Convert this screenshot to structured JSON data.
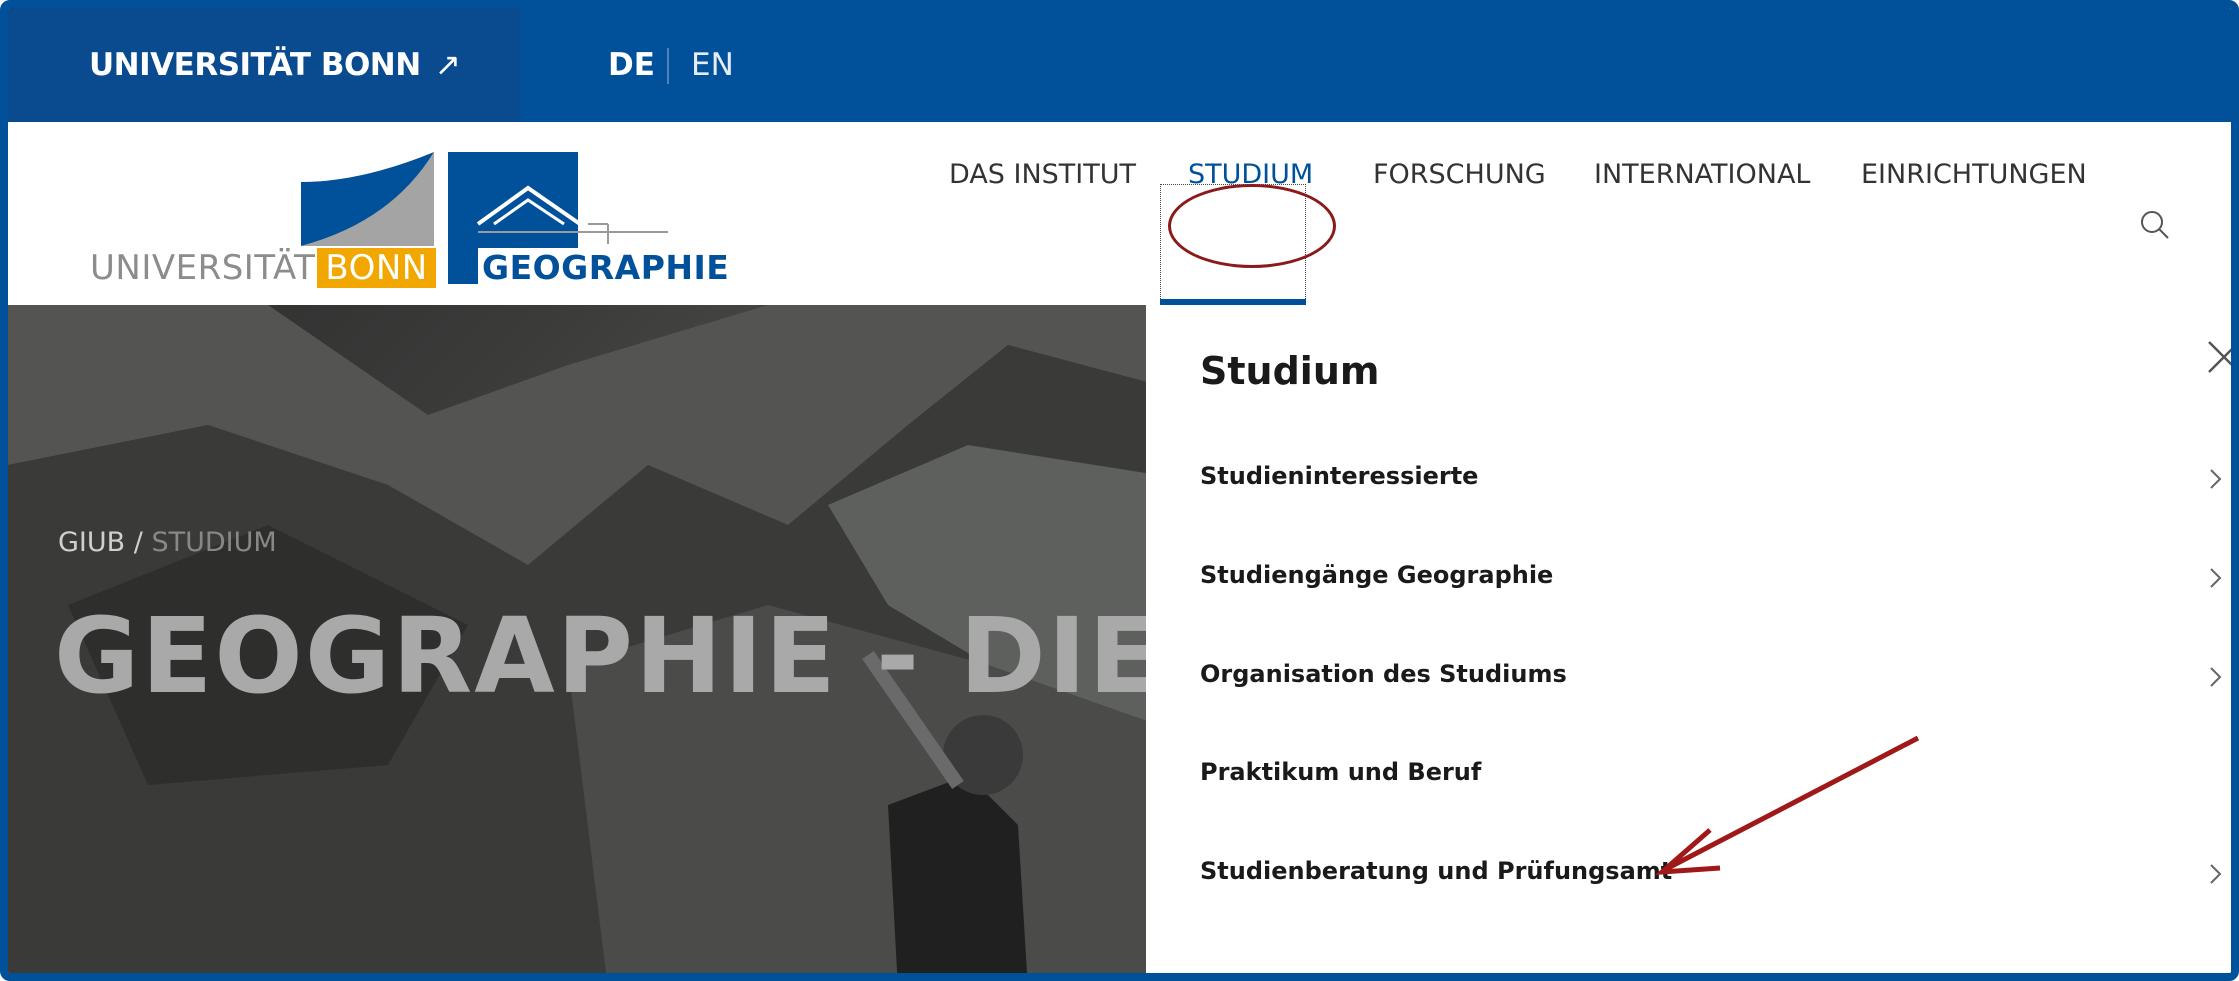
{
  "topbar": {
    "university_link": "UNIVERSITÄT BONN",
    "external_glyph": "↗",
    "lang_de": "DE",
    "lang_en": "EN"
  },
  "logos": {
    "uni_word": "UNIVERSITÄT",
    "uni_bonn": "BONN",
    "geo_word": "GEOGRAPHIE"
  },
  "nav": {
    "items": [
      {
        "label": "DAS INSTITUT"
      },
      {
        "label": "STUDIUM"
      },
      {
        "label": "FORSCHUNG"
      },
      {
        "label": "INTERNATIONAL"
      },
      {
        "label": "EINRICHTUNGEN"
      }
    ],
    "active": "STUDIUM",
    "search_icon": "search-icon"
  },
  "hero": {
    "breadcrumb_root": "GIUB",
    "breadcrumb_sep": " / ",
    "breadcrumb_current": "STUDIUM",
    "title": "GEOGRAPHIE - DIE WE"
  },
  "dropdown": {
    "title": "Studium",
    "close_icon": "close-icon",
    "items": [
      {
        "label": "Studieninteressierte",
        "has_chevron": true
      },
      {
        "label": "Studiengänge Geographie",
        "has_chevron": true
      },
      {
        "label": "Organisation des Studiums",
        "has_chevron": true
      },
      {
        "label": "Praktikum und Beruf",
        "has_chevron": false
      },
      {
        "label": "Studienberatung und Prüfungsamt",
        "has_chevron": true
      }
    ]
  },
  "colors": {
    "brand_blue": "#00509a",
    "bonn_orange": "#f2a700",
    "annotation_red": "#8b1a1a"
  }
}
